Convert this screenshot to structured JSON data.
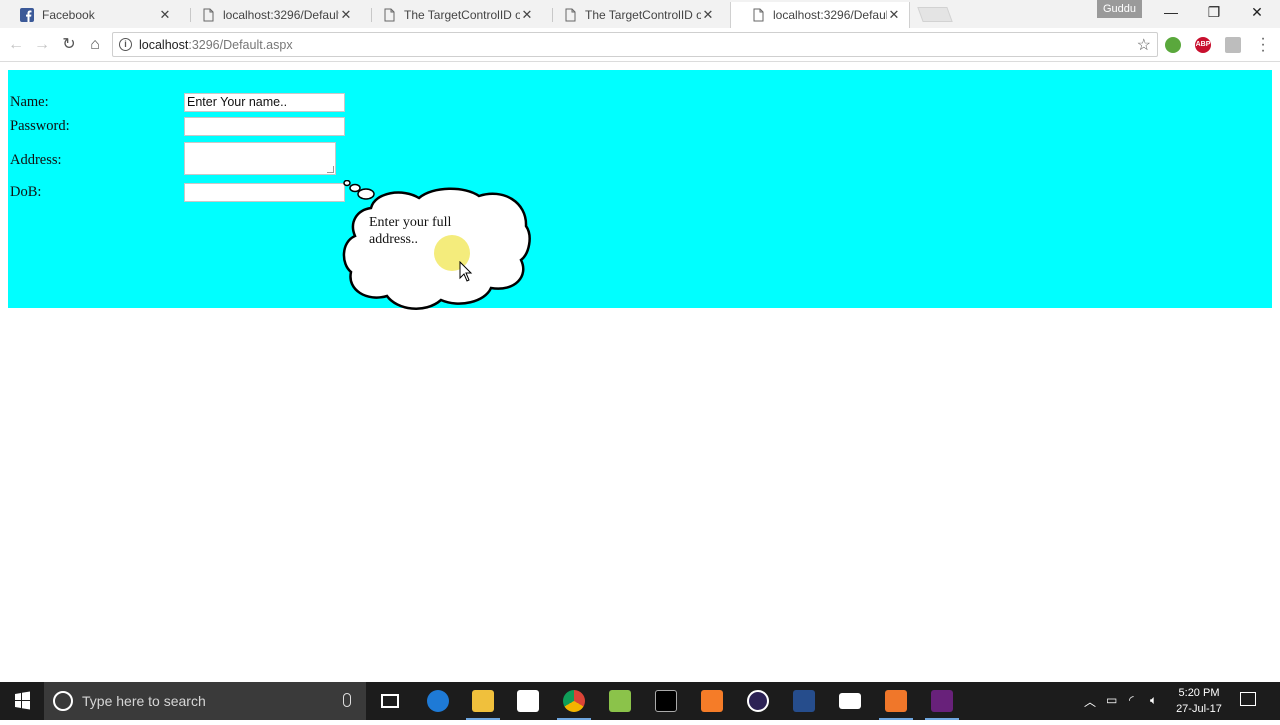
{
  "browser": {
    "tabs": [
      {
        "title": "Facebook",
        "active": false
      },
      {
        "title": "localhost:3296/Default.a",
        "active": false
      },
      {
        "title": "The TargetControlID of T",
        "active": false
      },
      {
        "title": "The TargetControlID of T",
        "active": false
      },
      {
        "title": "localhost:3296/Default.a",
        "active": true
      }
    ],
    "profile_name": "Guddu",
    "address": {
      "host": "localhost",
      "path": ":3296/Default.aspx"
    },
    "extensions": [
      "green-extension-icon",
      "adblock-plus-icon",
      "pdf-extension-icon"
    ]
  },
  "form": {
    "name_label": "Name:",
    "name_value": "Enter Your name..",
    "password_label": "Password:",
    "address_label": "Address:",
    "dob_label": "DoB:",
    "bubble_text": "Enter your full address.."
  },
  "taskbar": {
    "search_placeholder": "Type here to search",
    "time": "5:20 PM",
    "date": "27-Jul-17"
  },
  "colors": {
    "panel": "#00ffff",
    "taskbar": "#1c1c1c"
  }
}
